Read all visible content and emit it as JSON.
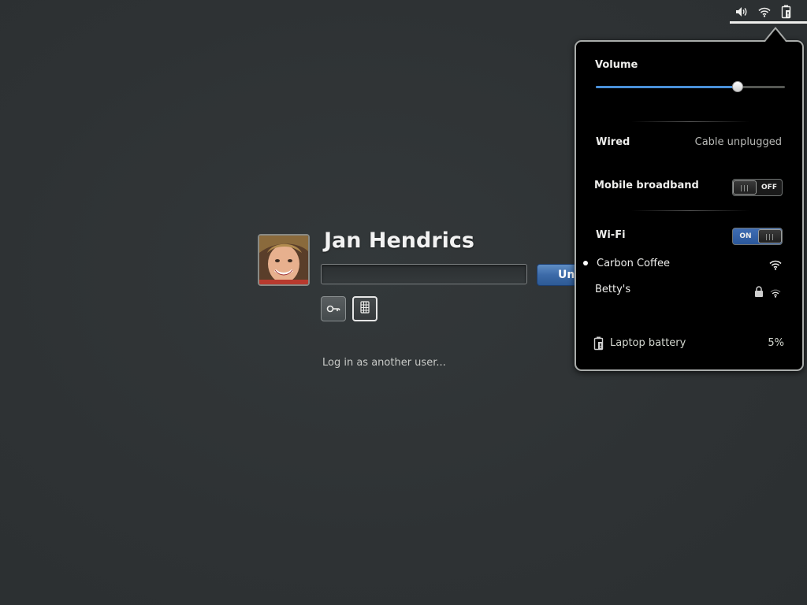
{
  "status_area": {
    "icons": [
      "volume-icon",
      "wifi-icon",
      "battery-icon"
    ]
  },
  "login": {
    "user_name": "Jan Hendrics",
    "password_value": "",
    "unlock_label": "Unlock",
    "auth_buttons": [
      "key-icon",
      "smartcard-icon"
    ],
    "other_user_link": "Log in as another user..."
  },
  "system_menu": {
    "volume": {
      "label": "Volume",
      "level_percent": 75
    },
    "wired": {
      "label": "Wired",
      "status": "Cable unplugged"
    },
    "mobile_broadband": {
      "label": "Mobile broadband",
      "toggle_state": "OFF"
    },
    "wifi": {
      "label": "Wi-Fi",
      "toggle_state": "ON",
      "networks": [
        {
          "name": "Carbon Coffee",
          "connected": true,
          "secured": false,
          "icon": "wifi-signal-icon"
        },
        {
          "name": "Betty's",
          "connected": false,
          "secured": true,
          "icon": "wifi-signal-icon"
        }
      ]
    },
    "battery": {
      "label": "Laptop battery",
      "percent": "5%"
    }
  },
  "colors": {
    "background": "#2e3436",
    "accent": "#4a90d9",
    "popup_background": "#000000",
    "toggle_on": "#3f6db3"
  }
}
